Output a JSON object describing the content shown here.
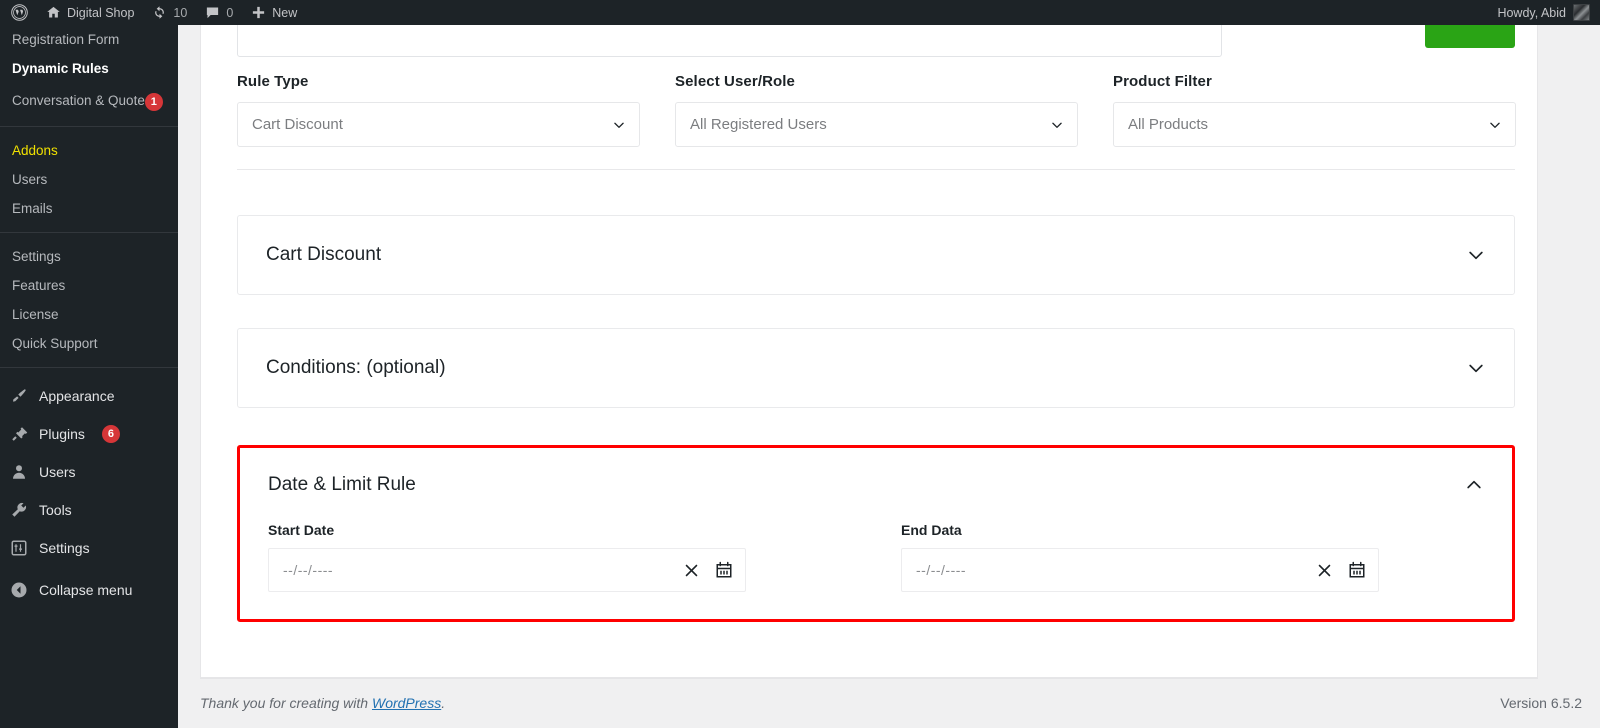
{
  "adminbar": {
    "site_name": "Digital Shop",
    "updates_count": "10",
    "comments_count": "0",
    "new_label": "New",
    "howdy": "Howdy, Abid",
    "icons": {
      "wordpress": "wordpress-logo-icon",
      "home": "home-icon",
      "updates": "updates-refresh-icon",
      "comments": "comment-bubble-icon",
      "new": "plus-icon",
      "avatar": "user-avatar"
    }
  },
  "sidebar": {
    "plugin_items": [
      {
        "label": "Registration Form",
        "active": false
      },
      {
        "label": "Dynamic Rules",
        "active": true
      },
      {
        "label": "Conversation & Quote",
        "active": false,
        "badge": "1"
      }
    ],
    "group2": [
      {
        "label": "Addons",
        "highlight": true
      },
      {
        "label": "Users"
      },
      {
        "label": "Emails"
      }
    ],
    "group3": [
      {
        "label": "Settings"
      },
      {
        "label": "Features"
      },
      {
        "label": "License"
      },
      {
        "label": "Quick Support"
      }
    ],
    "main_items": [
      {
        "label": "Appearance",
        "icon": "paintbrush-icon"
      },
      {
        "label": "Plugins",
        "icon": "plugin-plug-icon",
        "badge": "6"
      },
      {
        "label": "Users",
        "icon": "user-icon"
      },
      {
        "label": "Tools",
        "icon": "wrench-icon"
      },
      {
        "label": "Settings",
        "icon": "settings-sliders-icon"
      }
    ],
    "collapse_label": "Collapse menu",
    "collapse_icon": "arrow-left-circle-icon"
  },
  "form": {
    "fields": [
      {
        "label": "Rule Type",
        "value": "Cart Discount",
        "icon": "chevron-down-icon"
      },
      {
        "label": "Select User/Role",
        "value": "All Registered Users",
        "icon": "chevron-down-icon"
      },
      {
        "label": "Product Filter",
        "value": "All Products",
        "icon": "chevron-down-icon"
      }
    ]
  },
  "accordions": [
    {
      "title": "Cart Discount",
      "expanded": false,
      "icon": "chevron-down-icon"
    },
    {
      "title": "Conditions: (optional)",
      "expanded": false,
      "icon": "chevron-down-icon"
    },
    {
      "title": "Date & Limit Rule",
      "expanded": true,
      "icon": "chevron-up-icon"
    }
  ],
  "date_rule": {
    "start": {
      "label": "Start Date",
      "placeholder": "--/--/----",
      "clear_icon": "close-x-icon",
      "calendar_icon": "calendar-icon"
    },
    "end": {
      "label": "End Data",
      "placeholder": "--/--/----",
      "clear_icon": "close-x-icon",
      "calendar_icon": "calendar-icon"
    }
  },
  "footer": {
    "thanks_prefix": "Thank you for creating with ",
    "wordpress_link": "WordPress",
    "thanks_suffix": ".",
    "version": "Version 6.5.2"
  },
  "colors": {
    "admin_dark": "#1d2327",
    "badge_red": "#d63638",
    "addons_yellow": "#f0e000",
    "highlight_red": "#ff0000",
    "primary_green": "#2aa415",
    "link_blue": "#2271b1"
  }
}
